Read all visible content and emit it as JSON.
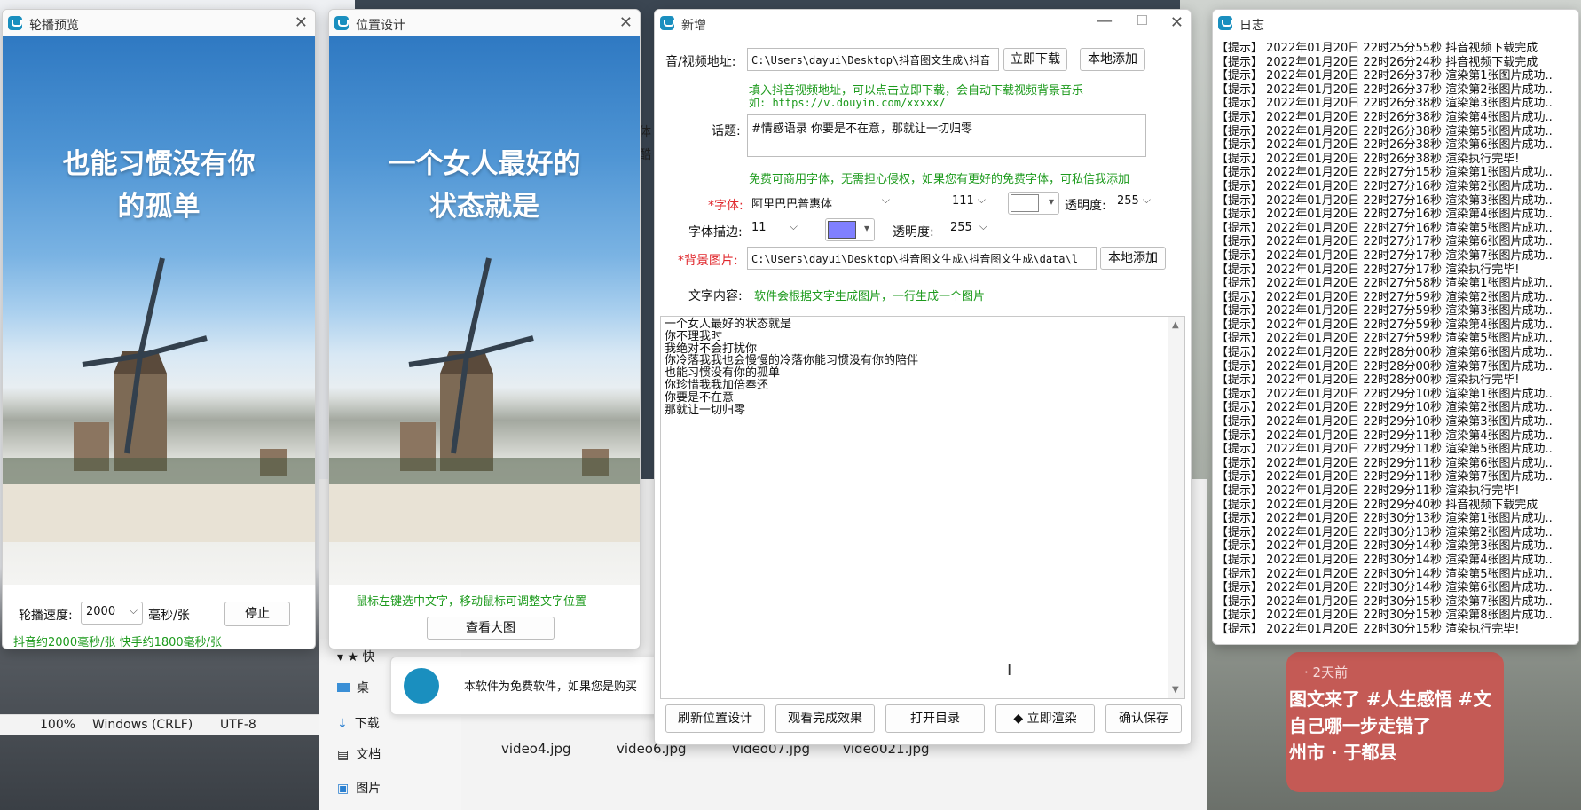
{
  "carousel": {
    "title": "轮播预览",
    "caption_l1": "也能习惯没有你",
    "caption_l2": "的孤单",
    "speed_label": "轮播速度:",
    "speed_value": "2000",
    "speed_unit": "毫秒/张",
    "stop_button": "停止",
    "hint": "抖音约2000毫秒/张 快手约1800毫秒/张"
  },
  "position": {
    "title": "位置设计",
    "caption_l1": "一个女人最好的",
    "caption_l2": "状态就是",
    "hint": "鼠标左键选中文字，移动鼠标可调整文字位置",
    "view_button": "查看大图"
  },
  "newwin": {
    "title": "新增",
    "audio_label": "音/视频地址:",
    "audio_value": "C:\\Users\\dayui\\Desktop\\抖音图文生成\\抖音",
    "download_button": "立即下载",
    "local_add_button": "本地添加",
    "audio_hint_l1": "填入抖音视频地址，可以点击立即下载，会自动下载视频背景音乐",
    "audio_hint_l2": "如: https://v.douyin.com/xxxxx/",
    "topic_label": "话题:",
    "topic_value": "#情感语录 你要是不在意，那就让一切归零",
    "font_hint": "免费可商用字体，无需担心侵权，如果您有更好的免费字体，可私信我添加",
    "font_star": "*",
    "font_label": "字体:",
    "font_value": "阿里巴巴普惠体",
    "font_size": "111",
    "font_alpha_label": "透明度:",
    "font_alpha": "255",
    "stroke_label": "字体描边:",
    "stroke_size": "11",
    "stroke_alpha_label": "透明度:",
    "stroke_alpha": "255",
    "bg_star": "*",
    "bg_label": "背景图片:",
    "bg_value": "C:\\Users\\dayui\\Desktop\\抖音图文生成\\抖音图文生成\\data\\l",
    "bg_local_button": "本地添加",
    "content_label": "文字内容:",
    "content_hint": "软件会根据文字生成图片，一行生成一个图片",
    "content_lines": [
      "一个女人最好的状态就是",
      "你不理我时",
      "我绝对不会打扰你",
      "你冷落我我也会慢慢的冷落你能习惯没有你的陪伴",
      "也能习惯没有你的孤单",
      "你珍惜我我加倍奉还",
      "你要是不在意",
      "那就让一切归零"
    ],
    "buttons": {
      "refresh": "刷新位置设计",
      "preview": "观看完成效果",
      "open_dir": "打开目录",
      "render": "立即渲染",
      "confirm": "确认保存"
    },
    "colors": {
      "font_color": "#ffffff",
      "stroke_color": "#8080ff"
    }
  },
  "log": {
    "title": "日志",
    "lines": [
      "【提示】 2022年01月20日 22时25分55秒 抖音视频下载完成",
      "【提示】 2022年01月20日 22时26分24秒 抖音视频下载完成",
      "【提示】 2022年01月20日 22时26分37秒 渲染第1张图片成功..",
      "【提示】 2022年01月20日 22时26分37秒 渲染第2张图片成功..",
      "【提示】 2022年01月20日 22时26分38秒 渲染第3张图片成功..",
      "【提示】 2022年01月20日 22时26分38秒 渲染第4张图片成功..",
      "【提示】 2022年01月20日 22时26分38秒 渲染第5张图片成功..",
      "【提示】 2022年01月20日 22时26分38秒 渲染第6张图片成功..",
      "【提示】 2022年01月20日 22时26分38秒 渲染执行完毕!",
      "【提示】 2022年01月20日 22时27分15秒 渲染第1张图片成功..",
      "【提示】 2022年01月20日 22时27分16秒 渲染第2张图片成功..",
      "【提示】 2022年01月20日 22时27分16秒 渲染第3张图片成功..",
      "【提示】 2022年01月20日 22时27分16秒 渲染第4张图片成功..",
      "【提示】 2022年01月20日 22时27分16秒 渲染第5张图片成功..",
      "【提示】 2022年01月20日 22时27分17秒 渲染第6张图片成功..",
      "【提示】 2022年01月20日 22时27分17秒 渲染第7张图片成功..",
      "【提示】 2022年01月20日 22时27分17秒 渲染执行完毕!",
      "【提示】 2022年01月20日 22时27分58秒 渲染第1张图片成功..",
      "【提示】 2022年01月20日 22时27分59秒 渲染第2张图片成功..",
      "【提示】 2022年01月20日 22时27分59秒 渲染第3张图片成功..",
      "【提示】 2022年01月20日 22时27分59秒 渲染第4张图片成功..",
      "【提示】 2022年01月20日 22时27分59秒 渲染第5张图片成功..",
      "【提示】 2022年01月20日 22时28分00秒 渲染第6张图片成功..",
      "【提示】 2022年01月20日 22时28分00秒 渲染第7张图片成功..",
      "【提示】 2022年01月20日 22时28分00秒 渲染执行完毕!",
      "【提示】 2022年01月20日 22时29分10秒 渲染第1张图片成功..",
      "【提示】 2022年01月20日 22时29分10秒 渲染第2张图片成功..",
      "【提示】 2022年01月20日 22时29分10秒 渲染第3张图片成功..",
      "【提示】 2022年01月20日 22时29分11秒 渲染第4张图片成功..",
      "【提示】 2022年01月20日 22时29分11秒 渲染第5张图片成功..",
      "【提示】 2022年01月20日 22时29分11秒 渲染第6张图片成功..",
      "【提示】 2022年01月20日 22时29分11秒 渲染第7张图片成功..",
      "【提示】 2022年01月20日 22时29分11秒 渲染执行完毕!",
      "【提示】 2022年01月20日 22时29分40秒 抖音视频下载完成",
      "【提示】 2022年01月20日 22时30分13秒 渲染第1张图片成功..",
      "【提示】 2022年01月20日 22时30分13秒 渲染第2张图片成功..",
      "【提示】 2022年01月20日 22时30分14秒 渲染第3张图片成功..",
      "【提示】 2022年01月20日 22时30分14秒 渲染第4张图片成功..",
      "【提示】 2022年01月20日 22时30分14秒 渲染第5张图片成功..",
      "【提示】 2022年01月20日 22时30分14秒 渲染第6张图片成功..",
      "【提示】 2022年01月20日 22时30分15秒 渲染第7张图片成功..",
      "【提示】 2022年01月20日 22时30分15秒 渲染第8张图片成功..",
      "【提示】 2022年01月20日 22时30分15秒 渲染执行完毕!"
    ]
  },
  "background": {
    "statusbar": {
      "zoom": "100%",
      "line_ending": "Windows (CRLF)",
      "encoding": "UTF-8"
    },
    "explorer": {
      "quick": "快",
      "desktop": "桌",
      "downloads": "下载",
      "documents": "文档",
      "pictures": "图片"
    },
    "files": [
      "video4.jpg",
      "video6.jpg",
      "video07.jpg",
      "video021.jpg"
    ],
    "notice_text": "本软件为免费软件，如果您是购买",
    "social": {
      "time": "· 2天前",
      "l1": "图文来了 #人生感悟 #文",
      "l2": "自己哪一步走错了",
      "l3": "州市 · 于都县"
    },
    "peek_l1": "体",
    "peek_l2": "酷"
  }
}
